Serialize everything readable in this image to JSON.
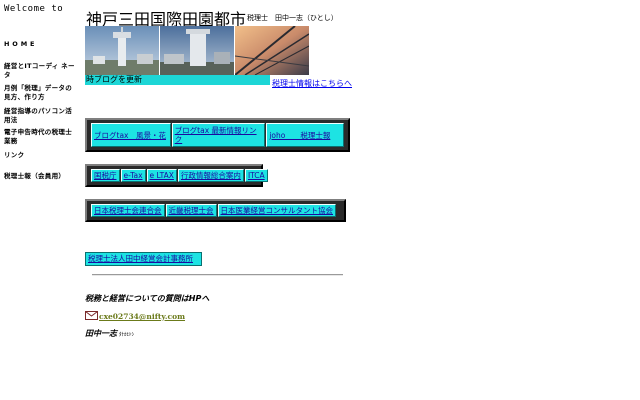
{
  "sidebar": {
    "welcome": "Welcome  to",
    "items": [
      {
        "label": "H O M E"
      },
      {
        "label": "経営とITコーディ ネータ"
      },
      {
        "label": "月例「税理」データの見方、作り方"
      },
      {
        "label": "経営指導のパソコン活用法"
      },
      {
        "label": "電子申告時代の税理士業務"
      },
      {
        "label": "リンク"
      },
      {
        "label": "税理士報（会員用）"
      }
    ]
  },
  "header": {
    "title": "神戸三田国際田園都市",
    "subtitle": "税理士　田中一志（ひとし）"
  },
  "photos": [
    "tower-photo",
    "building-photo",
    "sunset-photo"
  ],
  "blog_update": "時ブログを更新",
  "info_link": "税理士情報はこちらへ",
  "button_groups": [
    {
      "buttons": [
        "ブログtax　風景・花",
        "ブログtax 最新情報リンク",
        "joho　　税理士報"
      ]
    },
    {
      "buttons": [
        "国税庁",
        "e-Tax",
        "e LTAX",
        "行政情報総合案内",
        "ITCA"
      ]
    },
    {
      "buttons": [
        "日本税理士会連合会",
        "近畿税理士会",
        "日本医業経営コンサルタント協会"
      ]
    }
  ],
  "office_link": "税理士法人田中経営会計事務所",
  "footer": {
    "question": "税務と経営についての質問はHPへ",
    "email": "cxe02734@nifty.com",
    "signature_name": "田中一志",
    "signature_small": "ﾀﾅｶﾋﾄｼ"
  },
  "colors": {
    "button_bg": "#1de3e3",
    "bar_bg": "#2a2a2a",
    "link": "#0000ee",
    "email": "#6b7a1a"
  }
}
